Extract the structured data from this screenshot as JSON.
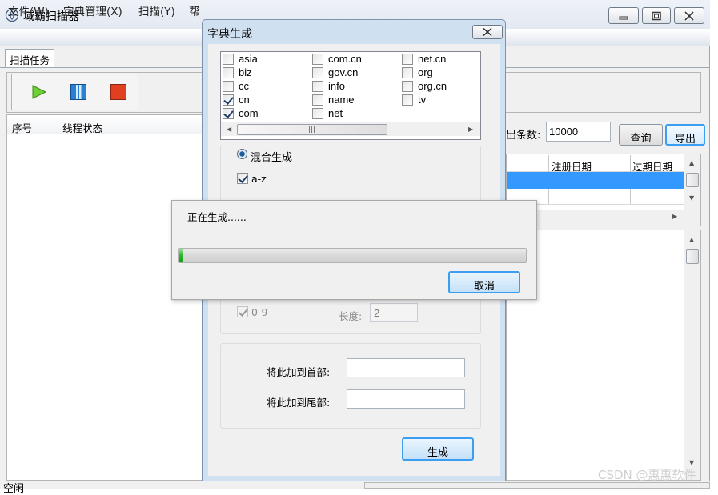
{
  "app": {
    "title": "域霸扫描器",
    "menu": [
      "文件(W)",
      "字典管理(X)",
      "扫描(Y)",
      "帮"
    ],
    "tab": "扫描任务",
    "left_grid_columns": [
      "序号",
      "线程状态"
    ],
    "export_count_label": "出条数:",
    "export_count_value": "10000",
    "query_button": "查询",
    "export_button": "导出",
    "result_columns": [
      "注册日期",
      "过期日期"
    ],
    "status_text": "空闲",
    "colors": {
      "play": "#5cc02a",
      "pause": "#2a7fd6",
      "stop": "#e0401f",
      "selection": "#3399ff"
    }
  },
  "dict_dialog": {
    "title": "字典生成",
    "tlds": [
      {
        "label": "asia",
        "checked": false
      },
      {
        "label": "biz",
        "checked": false
      },
      {
        "label": "cc",
        "checked": false
      },
      {
        "label": "cn",
        "checked": true
      },
      {
        "label": "com",
        "checked": true
      },
      {
        "label": "com.cn",
        "checked": false
      },
      {
        "label": "gov.cn",
        "checked": false
      },
      {
        "label": "info",
        "checked": false
      },
      {
        "label": "name",
        "checked": false
      },
      {
        "label": "net",
        "checked": false
      },
      {
        "label": "net.cn",
        "checked": false
      },
      {
        "label": "org",
        "checked": false
      },
      {
        "label": "org.cn",
        "checked": false
      },
      {
        "label": "tv",
        "checked": false
      }
    ],
    "mix_label": "混合生成",
    "az_label": "a-z",
    "digits_label": "0-9",
    "length_label": "长度:",
    "length_value": "2",
    "prefix_label": "将此加到首部:",
    "suffix_label": "将此加到尾部:",
    "generate_button": "生成"
  },
  "progress_dialog": {
    "message": "正在生成......",
    "progress": 0.01,
    "cancel_button": "取消"
  },
  "watermark": "CSDN @惠惠软件"
}
